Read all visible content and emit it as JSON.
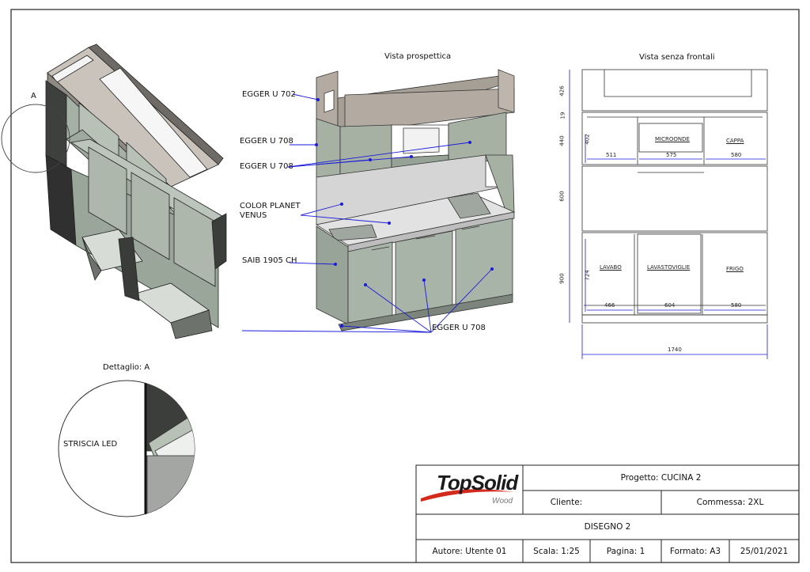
{
  "titles": {
    "perspective": "Vista prospettica",
    "no_fronts": "Vista senza frontali",
    "detail": "Dettaglio: A",
    "detail_marker": "A"
  },
  "labels": {
    "egger_u702": "EGGER U 702",
    "egger_u708_a": "EGGER U 708",
    "egger_u708_b": "EGGER U 708",
    "color_planet": "COLOR PLANET",
    "venus": "VENUS",
    "saib": "SAIB 1905 CH",
    "egger_u708_c": "EGGER U 708",
    "striscia_led": "STRISCIA LED"
  },
  "front_view": {
    "microonde": "MICROONDE",
    "cappa": "CAPPA",
    "lavabo": "LAVABO",
    "lavastoviglie": "LAVASTOVIGLIE",
    "frigo": "FRIGO",
    "d511": "511",
    "d575": "575",
    "d580a": "580",
    "d466": "466",
    "d604": "604",
    "d580b": "580",
    "d1740": "1740",
    "h426": "426",
    "h19": "19",
    "h440": "440",
    "h402": "402",
    "h600": "600",
    "h900": "900",
    "h724": "724"
  },
  "title_block": {
    "logo_main": "TopSolid",
    "logo_sub": "Wood",
    "progetto": "Progetto: CUCINA 2",
    "cliente": "Cliente:",
    "commessa": "Commessa: 2XL",
    "disegno": "DISEGNO 2",
    "autore": "Autore: Utente 01",
    "scala": "Scala: 1:25",
    "pagina": "Pagina: 1",
    "formato": "Formato: A3",
    "data": "25/01/2021"
  },
  "colors": {
    "border": "#222222",
    "leader": "#1a1adb",
    "cabinet_green": "#a9b4a8",
    "cabinet_dark": "#3d3f3d",
    "top_taupe": "#b4aca2",
    "backsplash": "#d6d6d6",
    "logo_red": "#d42a1e"
  }
}
